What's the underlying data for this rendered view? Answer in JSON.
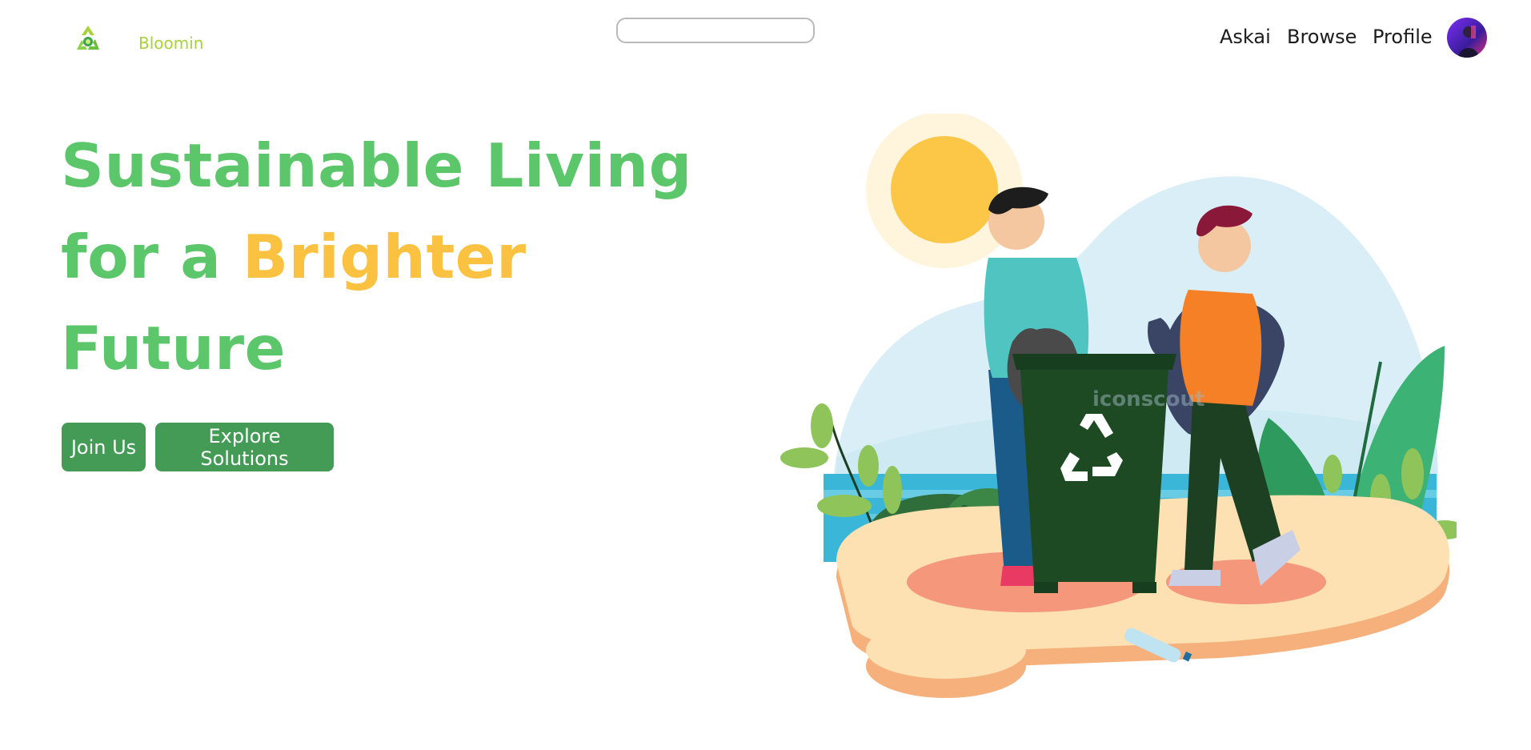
{
  "header": {
    "brand": "Bloomin",
    "search": {
      "value": "",
      "placeholder": ""
    },
    "nav": {
      "askai": "Askai",
      "browse": "Browse",
      "profile": "Profile"
    }
  },
  "hero": {
    "line1": "Sustainable Living",
    "line2_prefix": "for a",
    "line2_accent": "Brighter",
    "line3": "Future",
    "join_button": "Join Us",
    "explore_button": "Explore Solutions"
  },
  "illustration": {
    "bin_icon": "recycle-icon",
    "watermark": "iconscout"
  },
  "colors": {
    "primary_green": "#5cc66b",
    "accent_yellow": "#fbc140",
    "button_green": "#449b55",
    "brand_lime": "#a6d33c"
  }
}
